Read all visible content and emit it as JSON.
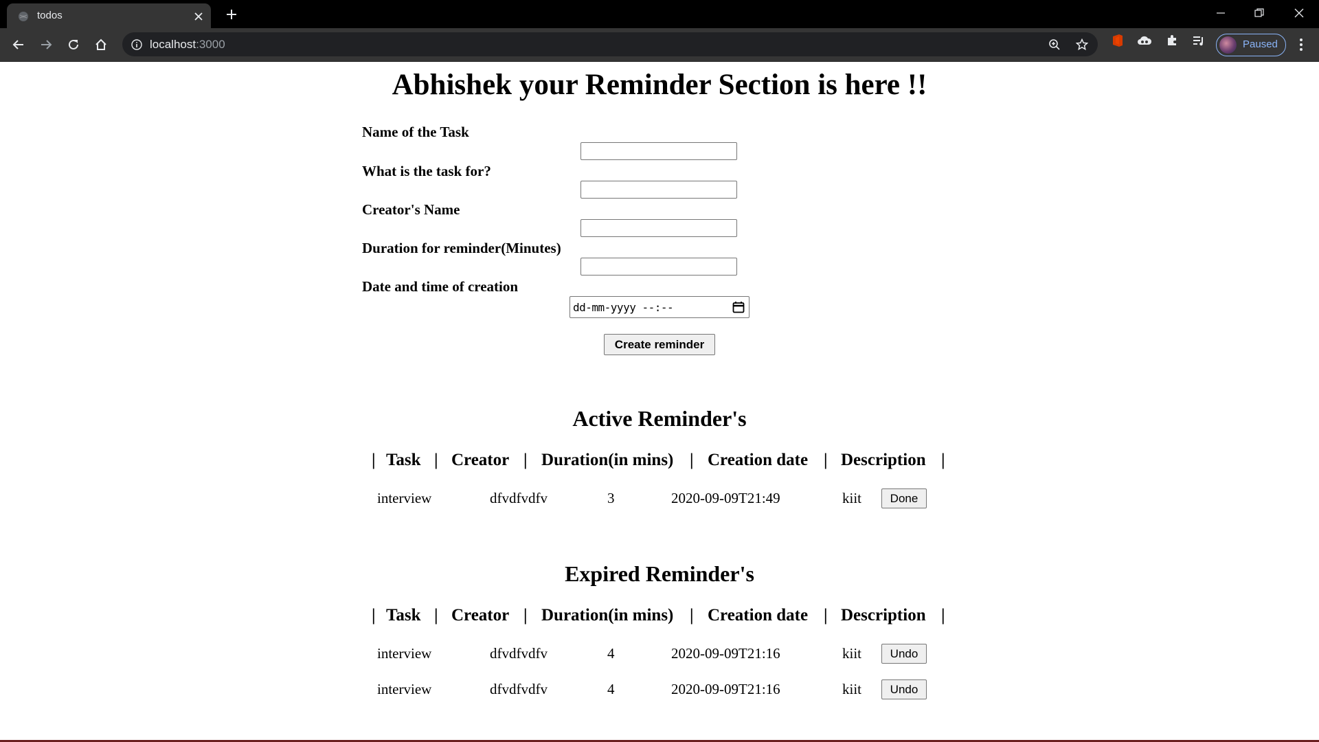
{
  "browser": {
    "tab_title": "todos",
    "url_host": "localhost",
    "url_port": ":3000",
    "profile_label": "Paused"
  },
  "page": {
    "title": "Abhishek your Reminder Section is here !!"
  },
  "form": {
    "fields": [
      {
        "label": "Name of the Task",
        "value": ""
      },
      {
        "label": "What is the task for?",
        "value": ""
      },
      {
        "label": "Creator's Name",
        "value": ""
      },
      {
        "label": "Duration for reminder(Minutes)",
        "value": ""
      }
    ],
    "datetime": {
      "label": "Date and time of creation",
      "placeholder": "dd-mm-yyyy --:--"
    },
    "submit_label": "Create reminder"
  },
  "table_headers": {
    "task": "Task",
    "creator": "Creator",
    "duration": "Duration(in mins)",
    "creation_date": "Creation date",
    "description": "Description",
    "separator": "|"
  },
  "active": {
    "heading": "Active Reminder's",
    "rows": [
      {
        "task": "interview",
        "creator": "dfvdfvdfv",
        "duration": "3",
        "date": "2020-09-09T21:49",
        "description": "kiit",
        "action": "Done"
      }
    ]
  },
  "expired": {
    "heading": "Expired Reminder's",
    "rows": [
      {
        "task": "interview",
        "creator": "dfvdfvdfv",
        "duration": "4",
        "date": "2020-09-09T21:16",
        "description": "kiit",
        "action": "Undo"
      },
      {
        "task": "interview",
        "creator": "dfvdfvdfv",
        "duration": "4",
        "date": "2020-09-09T21:16",
        "description": "kiit",
        "action": "Undo"
      }
    ]
  }
}
